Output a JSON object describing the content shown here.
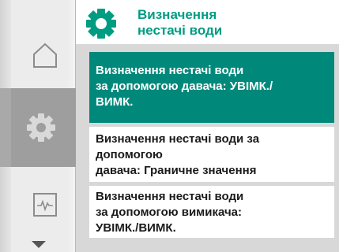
{
  "sidebar": {
    "items": [
      {
        "name": "home-icon",
        "active": false
      },
      {
        "name": "gear-icon",
        "active": true
      },
      {
        "name": "diagnostics-icon",
        "active": false
      }
    ],
    "scroll_indicator": "chevron-down-icon"
  },
  "header": {
    "icon": "gear-icon",
    "title": "Визначення\nнестачі води"
  },
  "menu": {
    "items": [
      {
        "label": "Визначення нестачі води\nза допомогою давача: УВІМК./\nВИМК.",
        "selected": true
      },
      {
        "label": "Визначення нестачі води за\nдопомогою\nдавача: Граничне значення",
        "selected": false
      },
      {
        "label": "Визначення нестачі води\nза допомогою вимикача:\nУВІМК./ВИМК.",
        "selected": false
      }
    ]
  },
  "colors": {
    "accent": "#009c82",
    "selected_bg": "#00897b",
    "background": "#d8d8d8"
  }
}
